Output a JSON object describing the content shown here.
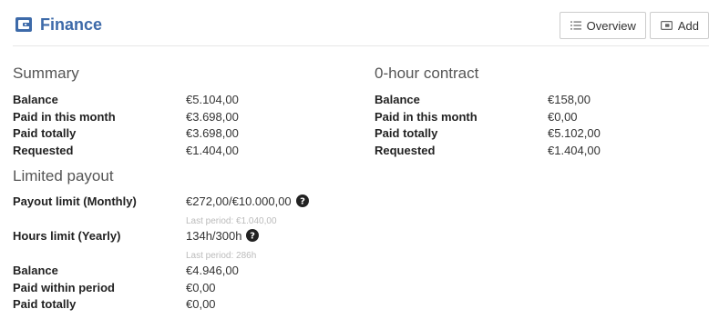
{
  "header": {
    "title": "Finance",
    "overview_label": "Overview",
    "add_label": "Add"
  },
  "summary": {
    "title": "Summary",
    "rows": [
      {
        "label": "Balance",
        "value": "€5.104,00"
      },
      {
        "label": "Paid in this month",
        "value": "€3.698,00"
      },
      {
        "label": "Paid totally",
        "value": "€3.698,00"
      },
      {
        "label": "Requested",
        "value": "€1.404,00"
      }
    ]
  },
  "limited": {
    "title": "Limited payout",
    "payout_limit": {
      "label": "Payout limit (Monthly)",
      "value": "€272,00/€10.000,00",
      "sub": "Last period: €1.040,00"
    },
    "hours_limit": {
      "label": "Hours limit (Yearly)",
      "value": "134h/300h",
      "sub": "Last period: 286h"
    },
    "rows": [
      {
        "label": "Balance",
        "value": "€4.946,00"
      },
      {
        "label": "Paid within period",
        "value": "€0,00"
      },
      {
        "label": "Paid totally",
        "value": "€0,00"
      }
    ]
  },
  "contract": {
    "title": "0-hour contract",
    "rows": [
      {
        "label": "Balance",
        "value": "€158,00"
      },
      {
        "label": "Paid in this month",
        "value": "€0,00"
      },
      {
        "label": "Paid totally",
        "value": "€5.102,00"
      },
      {
        "label": "Requested",
        "value": "€1.404,00"
      }
    ]
  },
  "colors": {
    "accent": "#3d6aa9",
    "border": "#cccccc",
    "muted": "#bbbbbb"
  },
  "icons": {
    "title": "wallet-icon",
    "overview": "list-icon",
    "add": "wallet-add-icon",
    "help": "question-circle-icon"
  }
}
